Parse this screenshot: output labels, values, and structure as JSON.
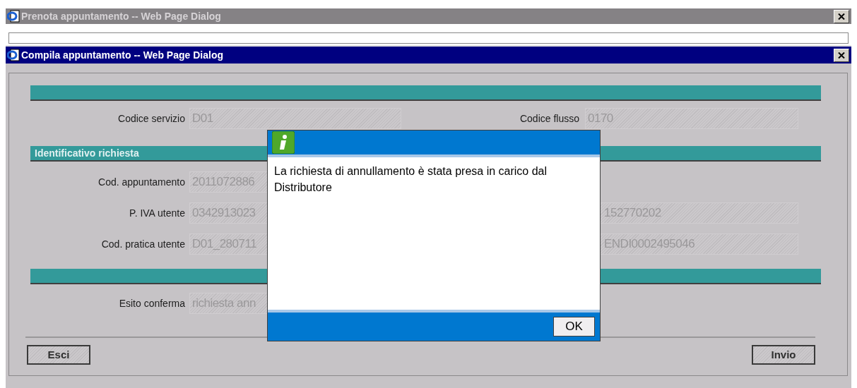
{
  "background_window": {
    "title": "Prenota appuntamento -- Web Page Dialog"
  },
  "window": {
    "title": "Compila appuntamento -- Web Page Dialog"
  },
  "form": {
    "rows": [
      {
        "kind": "section"
      },
      {
        "kind": "fields",
        "left": {
          "label": "Codice servizio",
          "value": "D01",
          "disabled": true
        },
        "right": {
          "label": "Codice flusso",
          "value": "0170",
          "disabled": true
        }
      },
      {
        "kind": "section",
        "title": "Identificativo richiesta"
      },
      {
        "kind": "fields",
        "left": {
          "label": "Cod. appuntamento",
          "value": "2011072886",
          "disabled": true
        }
      },
      {
        "kind": "fields",
        "left": {
          "label": "P. IVA utente",
          "value": "0342913023",
          "disabled": true
        },
        "right": {
          "value": "152770202",
          "disabled": true
        }
      },
      {
        "kind": "fields",
        "left": {
          "label": "Cod. pratica utente",
          "value": "D01_280711",
          "disabled": true
        },
        "right": {
          "value": "ENDI0002495046",
          "disabled": true
        }
      },
      {
        "kind": "section"
      },
      {
        "kind": "fields",
        "left": {
          "label": "Esito conferma",
          "value": "richiesta ann",
          "disabled": true
        }
      }
    ]
  },
  "buttons": [
    {
      "label": "Esci"
    },
    {
      "label": "Invio"
    }
  ],
  "message_box": {
    "message": "La richiesta di annullamento è stata presa in carico dal Distributore",
    "button": "OK"
  }
}
